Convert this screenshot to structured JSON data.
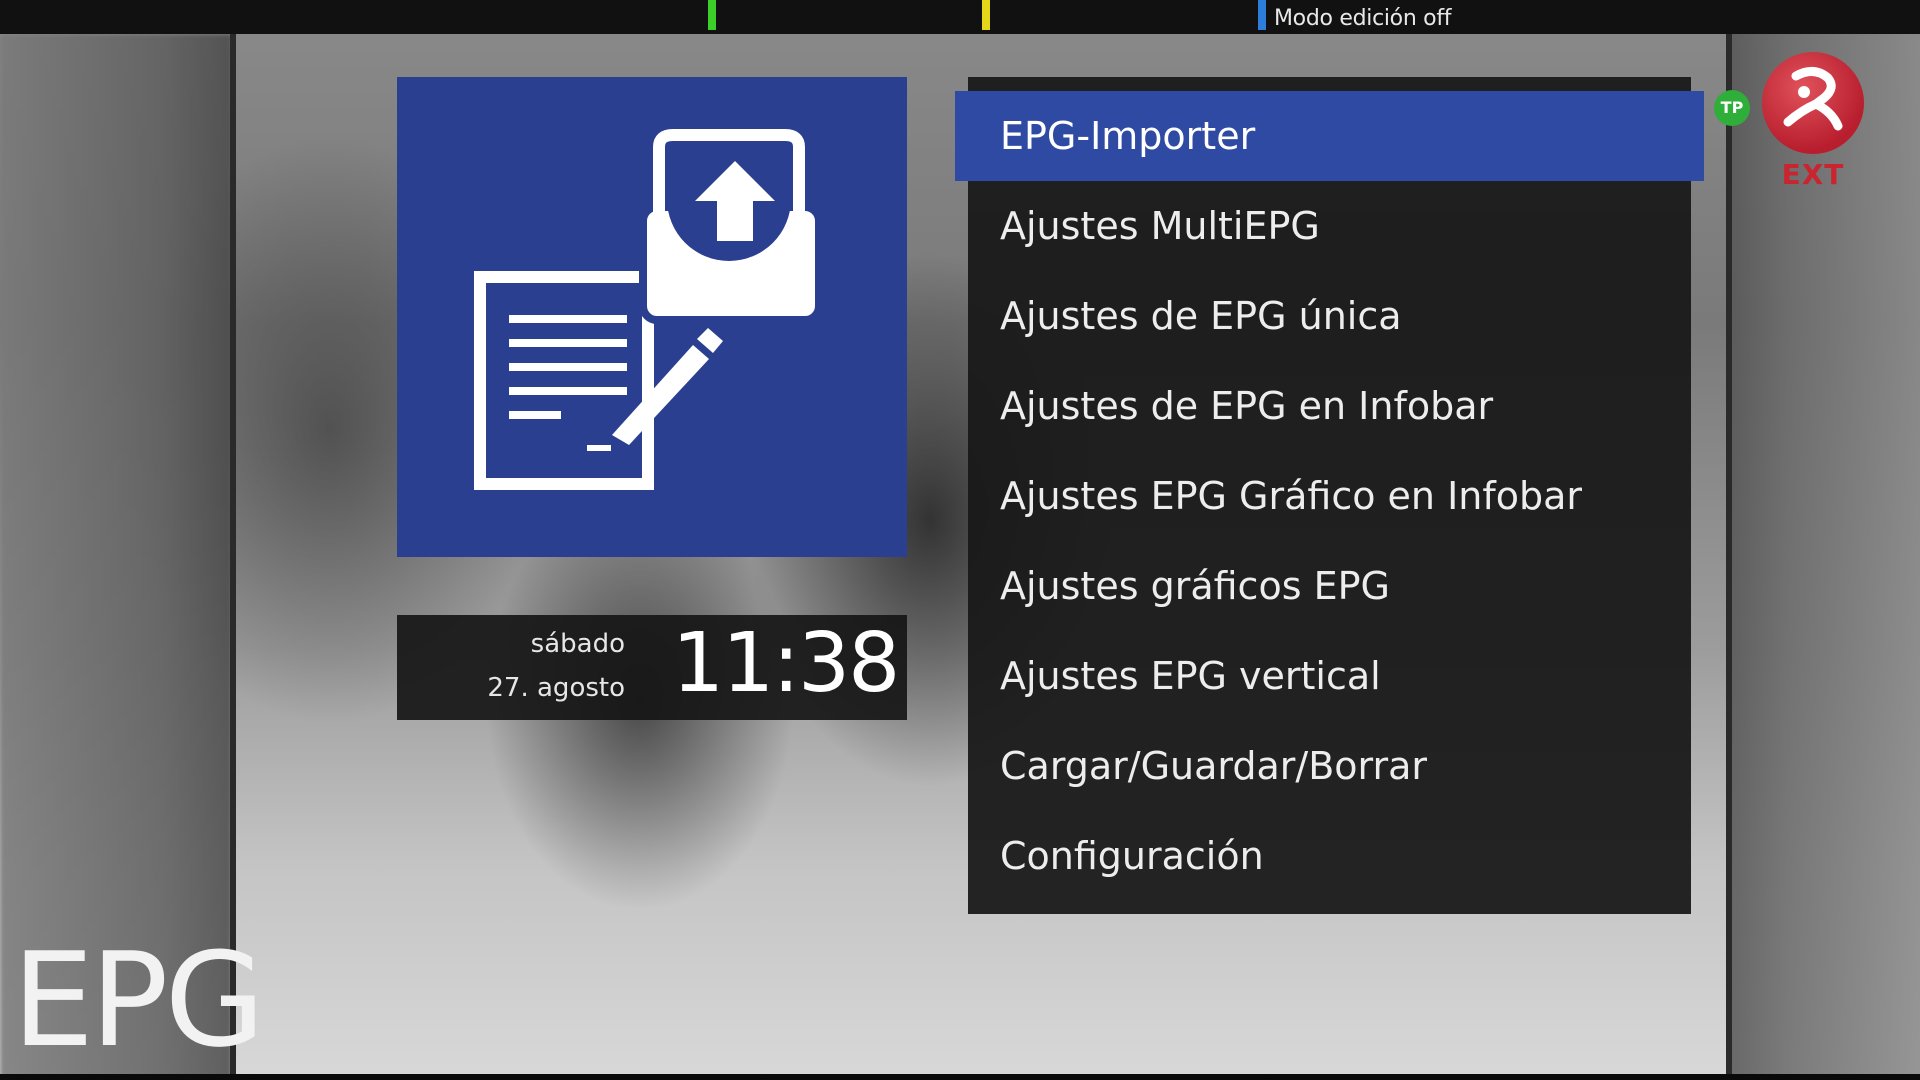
{
  "topbar": {
    "edit_mode": "Modo edición off",
    "key_colors": {
      "green": "#3ccf2a",
      "yellow": "#e6d619",
      "blue": "#2d7ddb"
    }
  },
  "icon_tile": {
    "icon": "epg-importer-icon",
    "color": "#2b3f91"
  },
  "clock": {
    "day": "sábado",
    "date": "27. agosto",
    "time": "11:38"
  },
  "menu": {
    "selected_color": "#2e4aa3",
    "items": [
      {
        "label": "EPG-Importer",
        "selected": true
      },
      {
        "label": "Ajustes MultiEPG"
      },
      {
        "label": "Ajustes de EPG única"
      },
      {
        "label": "Ajustes de EPG en Infobar"
      },
      {
        "label": "Ajustes EPG Gráfico en Infobar"
      },
      {
        "label": "Ajustes gráficos EPG"
      },
      {
        "label": "Ajustes EPG vertical"
      },
      {
        "label": "Cargar/Guardar/Borrar"
      },
      {
        "label": "Configuración"
      }
    ]
  },
  "channel": {
    "tp_badge": "TP",
    "logo_icon": "channel-logo-icon",
    "name": "EXT"
  },
  "section_title": "EPG"
}
